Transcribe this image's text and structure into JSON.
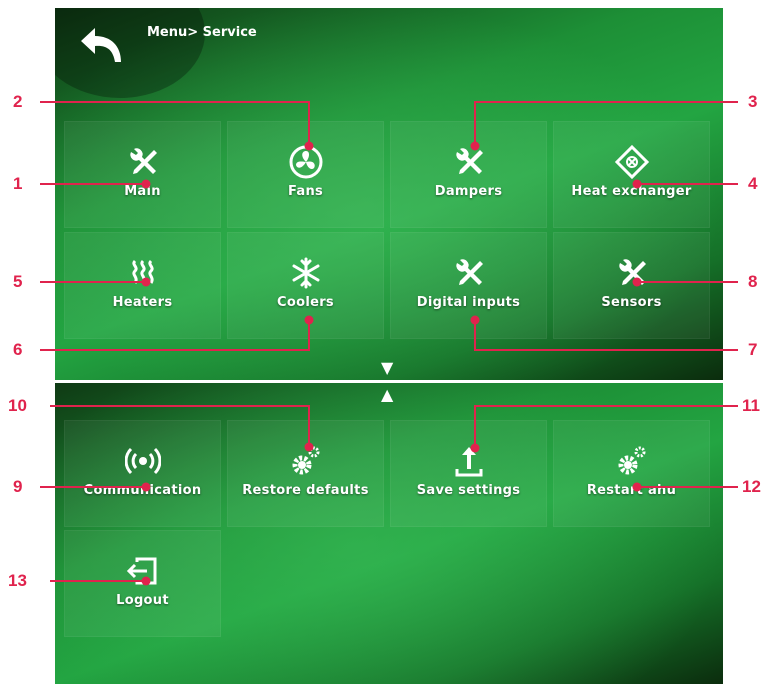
{
  "breadcrumb": "Menu> Service",
  "tiles_top": [
    {
      "label": "Main",
      "icon": "wrench-screwdriver-icon"
    },
    {
      "label": "Fans",
      "icon": "fan-icon"
    },
    {
      "label": "Dampers",
      "icon": "wrench-screwdriver-icon"
    },
    {
      "label": "Heat exchanger",
      "icon": "heat-exchanger-icon"
    },
    {
      "label": "Heaters",
      "icon": "heater-waves-icon"
    },
    {
      "label": "Coolers",
      "icon": "snowflake-icon"
    },
    {
      "label": "Digital inputs",
      "icon": "wrench-screwdriver-icon"
    },
    {
      "label": "Sensors",
      "icon": "wrench-screwdriver-icon"
    }
  ],
  "tiles_bottom": [
    {
      "label": "Communication",
      "icon": "signal-broadcast-icon"
    },
    {
      "label": "Restore defaults",
      "icon": "gears-icon"
    },
    {
      "label": "Save settings",
      "icon": "upload-icon"
    },
    {
      "label": "Restart ahu",
      "icon": "gears-icon"
    },
    {
      "label": "Logout",
      "icon": "logout-icon"
    }
  ],
  "scroll": {
    "down": "▼",
    "up": "▲"
  },
  "callouts": [
    "1",
    "2",
    "3",
    "4",
    "5",
    "6",
    "7",
    "8",
    "9",
    "10",
    "11",
    "12",
    "13"
  ],
  "colors": {
    "accent": "#e0234d",
    "panel": "#1d8f36"
  }
}
